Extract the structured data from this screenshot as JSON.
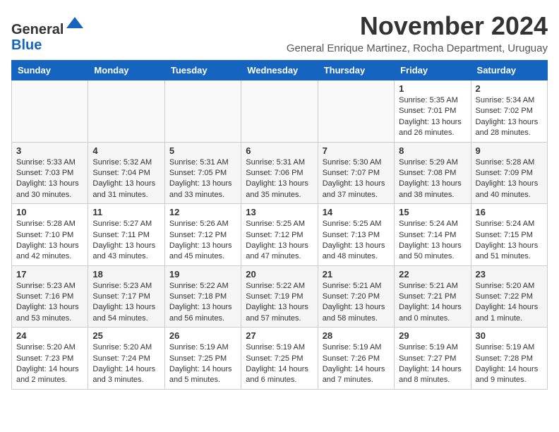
{
  "logo": {
    "general": "General",
    "blue": "Blue"
  },
  "header": {
    "month_title": "November 2024",
    "subtitle": "General Enrique Martinez, Rocha Department, Uruguay"
  },
  "weekdays": [
    "Sunday",
    "Monday",
    "Tuesday",
    "Wednesday",
    "Thursday",
    "Friday",
    "Saturday"
  ],
  "weeks": [
    [
      {
        "day": "",
        "info": ""
      },
      {
        "day": "",
        "info": ""
      },
      {
        "day": "",
        "info": ""
      },
      {
        "day": "",
        "info": ""
      },
      {
        "day": "",
        "info": ""
      },
      {
        "day": "1",
        "info": "Sunrise: 5:35 AM\nSunset: 7:01 PM\nDaylight: 13 hours\nand 26 minutes."
      },
      {
        "day": "2",
        "info": "Sunrise: 5:34 AM\nSunset: 7:02 PM\nDaylight: 13 hours\nand 28 minutes."
      }
    ],
    [
      {
        "day": "3",
        "info": "Sunrise: 5:33 AM\nSunset: 7:03 PM\nDaylight: 13 hours\nand 30 minutes."
      },
      {
        "day": "4",
        "info": "Sunrise: 5:32 AM\nSunset: 7:04 PM\nDaylight: 13 hours\nand 31 minutes."
      },
      {
        "day": "5",
        "info": "Sunrise: 5:31 AM\nSunset: 7:05 PM\nDaylight: 13 hours\nand 33 minutes."
      },
      {
        "day": "6",
        "info": "Sunrise: 5:31 AM\nSunset: 7:06 PM\nDaylight: 13 hours\nand 35 minutes."
      },
      {
        "day": "7",
        "info": "Sunrise: 5:30 AM\nSunset: 7:07 PM\nDaylight: 13 hours\nand 37 minutes."
      },
      {
        "day": "8",
        "info": "Sunrise: 5:29 AM\nSunset: 7:08 PM\nDaylight: 13 hours\nand 38 minutes."
      },
      {
        "day": "9",
        "info": "Sunrise: 5:28 AM\nSunset: 7:09 PM\nDaylight: 13 hours\nand 40 minutes."
      }
    ],
    [
      {
        "day": "10",
        "info": "Sunrise: 5:28 AM\nSunset: 7:10 PM\nDaylight: 13 hours\nand 42 minutes."
      },
      {
        "day": "11",
        "info": "Sunrise: 5:27 AM\nSunset: 7:11 PM\nDaylight: 13 hours\nand 43 minutes."
      },
      {
        "day": "12",
        "info": "Sunrise: 5:26 AM\nSunset: 7:12 PM\nDaylight: 13 hours\nand 45 minutes."
      },
      {
        "day": "13",
        "info": "Sunrise: 5:25 AM\nSunset: 7:12 PM\nDaylight: 13 hours\nand 47 minutes."
      },
      {
        "day": "14",
        "info": "Sunrise: 5:25 AM\nSunset: 7:13 PM\nDaylight: 13 hours\nand 48 minutes."
      },
      {
        "day": "15",
        "info": "Sunrise: 5:24 AM\nSunset: 7:14 PM\nDaylight: 13 hours\nand 50 minutes."
      },
      {
        "day": "16",
        "info": "Sunrise: 5:24 AM\nSunset: 7:15 PM\nDaylight: 13 hours\nand 51 minutes."
      }
    ],
    [
      {
        "day": "17",
        "info": "Sunrise: 5:23 AM\nSunset: 7:16 PM\nDaylight: 13 hours\nand 53 minutes."
      },
      {
        "day": "18",
        "info": "Sunrise: 5:23 AM\nSunset: 7:17 PM\nDaylight: 13 hours\nand 54 minutes."
      },
      {
        "day": "19",
        "info": "Sunrise: 5:22 AM\nSunset: 7:18 PM\nDaylight: 13 hours\nand 56 minutes."
      },
      {
        "day": "20",
        "info": "Sunrise: 5:22 AM\nSunset: 7:19 PM\nDaylight: 13 hours\nand 57 minutes."
      },
      {
        "day": "21",
        "info": "Sunrise: 5:21 AM\nSunset: 7:20 PM\nDaylight: 13 hours\nand 58 minutes."
      },
      {
        "day": "22",
        "info": "Sunrise: 5:21 AM\nSunset: 7:21 PM\nDaylight: 14 hours\nand 0 minutes."
      },
      {
        "day": "23",
        "info": "Sunrise: 5:20 AM\nSunset: 7:22 PM\nDaylight: 14 hours\nand 1 minute."
      }
    ],
    [
      {
        "day": "24",
        "info": "Sunrise: 5:20 AM\nSunset: 7:23 PM\nDaylight: 14 hours\nand 2 minutes."
      },
      {
        "day": "25",
        "info": "Sunrise: 5:20 AM\nSunset: 7:24 PM\nDaylight: 14 hours\nand 3 minutes."
      },
      {
        "day": "26",
        "info": "Sunrise: 5:19 AM\nSunset: 7:25 PM\nDaylight: 14 hours\nand 5 minutes."
      },
      {
        "day": "27",
        "info": "Sunrise: 5:19 AM\nSunset: 7:25 PM\nDaylight: 14 hours\nand 6 minutes."
      },
      {
        "day": "28",
        "info": "Sunrise: 5:19 AM\nSunset: 7:26 PM\nDaylight: 14 hours\nand 7 minutes."
      },
      {
        "day": "29",
        "info": "Sunrise: 5:19 AM\nSunset: 7:27 PM\nDaylight: 14 hours\nand 8 minutes."
      },
      {
        "day": "30",
        "info": "Sunrise: 5:19 AM\nSunset: 7:28 PM\nDaylight: 14 hours\nand 9 minutes."
      }
    ]
  ]
}
